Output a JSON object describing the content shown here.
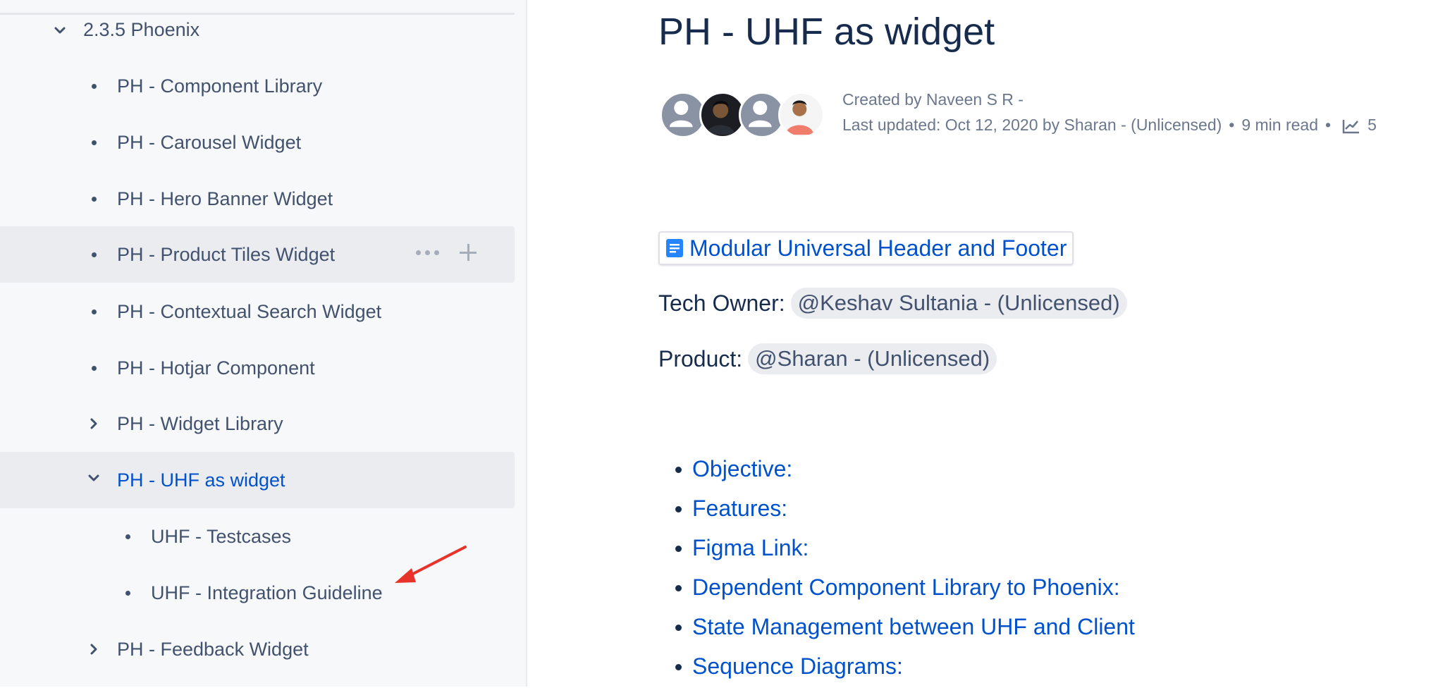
{
  "sidebar": {
    "section": {
      "label": "2.3.5 Phoenix"
    },
    "items": [
      {
        "label": "PH - Component Library"
      },
      {
        "label": "PH - Carousel Widget"
      },
      {
        "label": "PH - Hero Banner Widget"
      },
      {
        "label": "PH - Product Tiles Widget"
      },
      {
        "label": "PH - Contextual Search Widget"
      },
      {
        "label": "PH - Hotjar Component"
      },
      {
        "label": "PH - Widget Library"
      },
      {
        "label": "PH - UHF as widget"
      },
      {
        "label": "UHF - Testcases"
      },
      {
        "label": "UHF - Integration Guideline"
      },
      {
        "label": "PH - Feedback Widget"
      }
    ]
  },
  "page": {
    "title": "PH - UHF as widget",
    "created_by": "Created by Naveen S R -",
    "last_updated": "Last updated: Oct 12, 2020 by Sharan - (Unlicensed)",
    "read_time": "9 min read",
    "analytics_value": "5",
    "page_link": "Modular Universal Header and Footer",
    "tech_owner_label": "Tech Owner:",
    "tech_owner_mention": "@Keshav Sultania - (Unlicensed)",
    "product_label": "Product:",
    "product_mention": "@Sharan - (Unlicensed)",
    "toc": [
      "Objective:",
      "Features:",
      "Figma Link:",
      "Dependent Component Library to Phoenix:",
      "State Management between UHF and Client",
      "Sequence Diagrams:"
    ]
  },
  "colors": {
    "link": "#0052cc",
    "text": "#172b4d",
    "sidebar_bg": "#f7f8f9",
    "selected_bg": "#ebecf0",
    "annotation": "#e8332a"
  },
  "icons": [
    "chevron-down-icon",
    "chevron-right-icon",
    "more-icon",
    "plus-icon",
    "doc-icon",
    "analytics-icon",
    "user-icon"
  ]
}
